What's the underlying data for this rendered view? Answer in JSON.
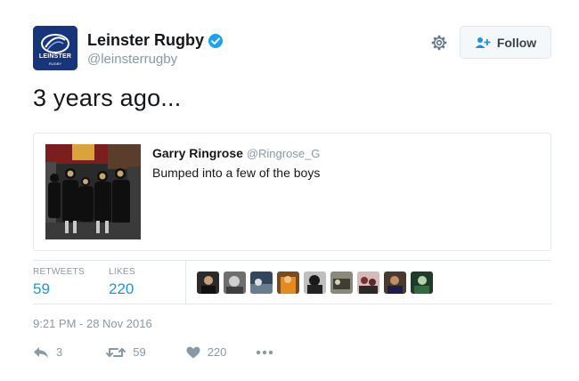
{
  "account": {
    "display_name": "Leinster Rugby",
    "handle": "@leinsterrugby",
    "verified": true,
    "logo_text_top": "LEINSTER",
    "logo_text_bottom": "RUGBY"
  },
  "header": {
    "follow_label": "Follow"
  },
  "tweet": {
    "text": "3 years ago...",
    "timestamp": "9:21 PM - 28 Nov 2016"
  },
  "quote": {
    "author_name": "Garry Ringrose",
    "author_handle": "@Ringrose_G",
    "text": "Bumped into a few of the boys"
  },
  "stats": {
    "retweets_label": "RETWEETS",
    "retweets_value": "59",
    "likes_label": "LIKES",
    "likes_value": "220"
  },
  "actions": {
    "reply_count": "3",
    "retweet_count": "59",
    "like_count": "220"
  },
  "colors": {
    "link_blue": "#1b95e0",
    "muted": "#8899a6",
    "leinster_blue": "#16357a"
  }
}
